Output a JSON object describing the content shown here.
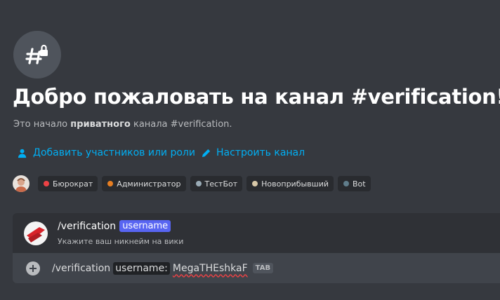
{
  "welcome": {
    "title": "Добро пожаловать на канал #verification!",
    "subtitle_prefix": "Это начало ",
    "subtitle_bold": "приватного",
    "subtitle_suffix": " канала #verification.",
    "channel_icon": "hashtag-lock-icon"
  },
  "actions": {
    "add_members": "Добавить участников или роли",
    "configure": "Настроить канал"
  },
  "roles": [
    {
      "label": "Бюрократ",
      "color": "#ed4245"
    },
    {
      "label": "Администратор",
      "color": "#e67e22"
    },
    {
      "label": "ТестБот",
      "color": "#99aab5"
    },
    {
      "label": "Новоприбывший",
      "color": "#d8c8a8"
    },
    {
      "label": "Bot",
      "color": "#607d8b"
    }
  ],
  "command": {
    "name": "/verification",
    "option": "username",
    "description": "Укажите ваш никнейм на вики"
  },
  "input": {
    "command_text": "/verification",
    "option_label": "username:",
    "option_value": "MegaTHEshkaF",
    "tab_hint": "TAB"
  },
  "colors": {
    "link": "#00aff4",
    "accent": "#5865f2",
    "spell_error": "#ed4245"
  }
}
